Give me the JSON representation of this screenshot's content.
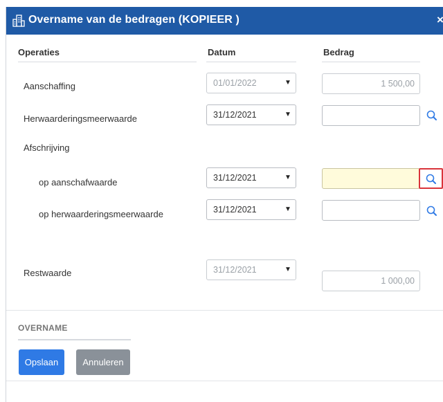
{
  "dialog": {
    "title": "Overname van de bedragen (KOPIEER   )",
    "title_icon": "building-icon",
    "close_label": "×"
  },
  "columns": {
    "operations": "Operaties",
    "date": "Datum",
    "amount": "Bedrag"
  },
  "rows": {
    "aanschaffing": {
      "label": "Aanschaffing",
      "date": "01/01/2022",
      "amount": "1 500,00"
    },
    "herwaardering": {
      "label": "Herwaarderingsmeerwaarde",
      "date": "31/12/2021",
      "amount": ""
    },
    "afschrijving": {
      "label": "Afschrijving"
    },
    "op_aanschaf": {
      "label": "op aanschafwaarde",
      "date": "31/12/2021",
      "amount": ""
    },
    "op_herwaardering": {
      "label": "op herwaarderingsmeerwaarde",
      "date": "31/12/2021",
      "amount": ""
    },
    "restwaarde": {
      "label": "Restwaarde",
      "date": "31/12/2021",
      "amount": "1 000,00"
    }
  },
  "select_arrow": "▼",
  "footer": {
    "section_title": "OVERNAME",
    "save_label": "Opslaan",
    "cancel_label": "Annuleren"
  },
  "colors": {
    "title_bar": "#1f5aa6",
    "primary_button": "#2f7ae5",
    "secondary_button": "#8a9199",
    "highlight_field": "#fffbdb",
    "focus_outline": "#d9333a"
  }
}
